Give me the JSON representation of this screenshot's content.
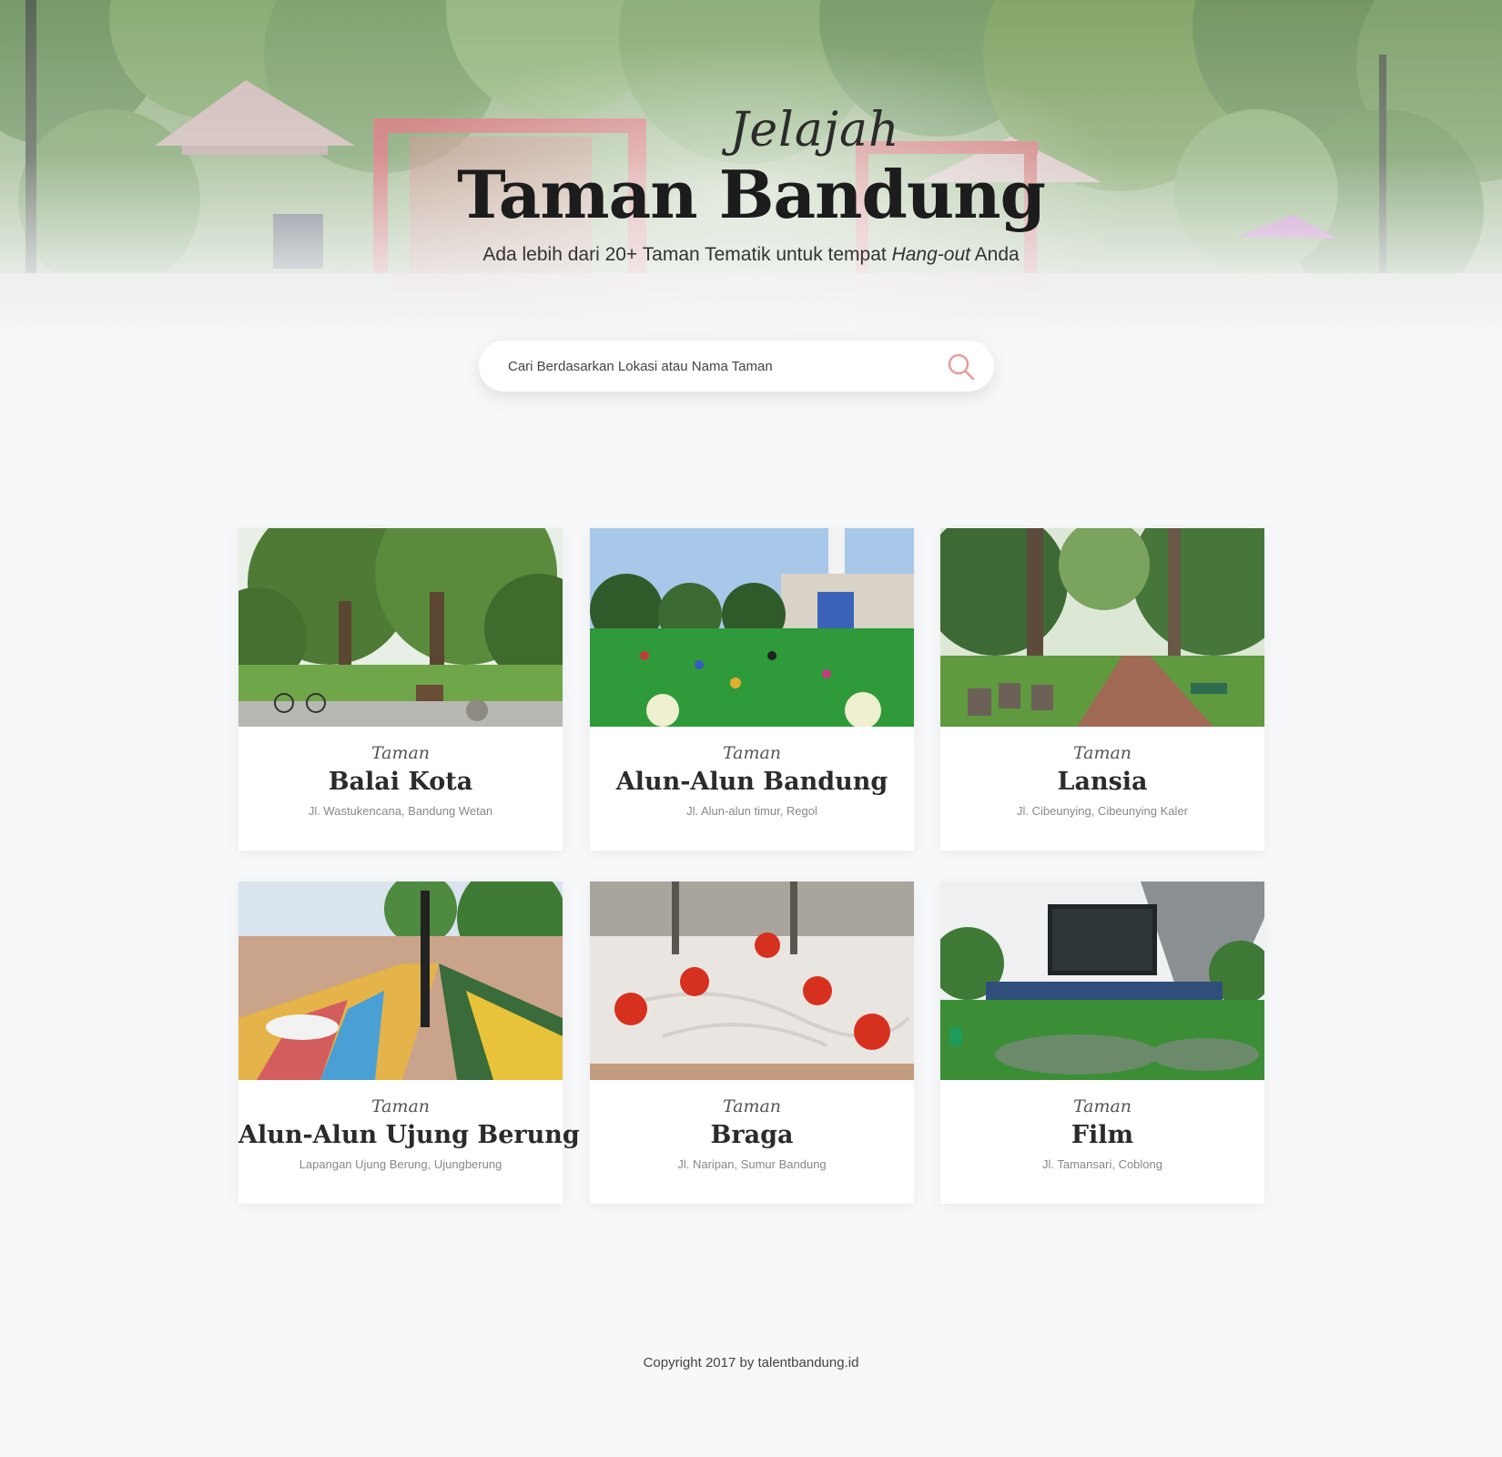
{
  "hero": {
    "kicker": "Jelajah",
    "title": "Taman Bandung",
    "subtitle_before": "Ada lebih dari 20+ Taman Tematik untuk tempat ",
    "subtitle_emphasis": "Hang-out",
    "subtitle_after": " Anda"
  },
  "search": {
    "placeholder": "Cari Berdasarkan Lokasi atau Nama Taman",
    "icon": "search-icon",
    "accent_color": "#e79a9a"
  },
  "parks": [
    {
      "kicker": "Taman",
      "name": "Balai Kota",
      "address": "Jl. Wastukencana, Bandung Wetan",
      "image": "park-balai-kota-photo"
    },
    {
      "kicker": "Taman",
      "name": "Alun-Alun Bandung",
      "address": "Jl. Alun-alun timur, Regol",
      "image": "park-alun-alun-bandung-photo"
    },
    {
      "kicker": "Taman",
      "name": "Lansia",
      "address": "Jl. Cibeunying, Cibeunying Kaler",
      "image": "park-lansia-photo"
    },
    {
      "kicker": "Taman",
      "name": "Alun-Alun Ujung Berung",
      "address": "Lapangan Ujung Berung, Ujungberung",
      "image": "park-ujung-berung-photo"
    },
    {
      "kicker": "Taman",
      "name": "Braga",
      "address": "Jl. Naripan, Sumur Bandung",
      "image": "park-braga-photo"
    },
    {
      "kicker": "Taman",
      "name": "Film",
      "address": "Jl. Tamansari, Coblong",
      "image": "park-film-photo"
    }
  ],
  "footer": {
    "copyright": "Copyright 2017 by talentbandung.id"
  }
}
